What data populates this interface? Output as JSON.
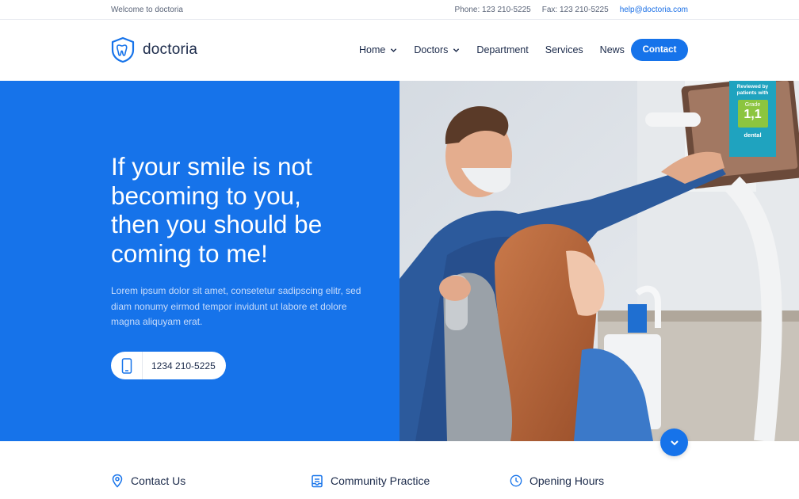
{
  "topbar": {
    "welcome": "Welcome to doctoria",
    "phone": "Phone: 123 210-5225",
    "fax": "Fax: 123 210-5225",
    "email": "help@doctoria.com"
  },
  "brand": {
    "name": "doctoria"
  },
  "nav": {
    "items": [
      {
        "label": "Home",
        "dropdown": true
      },
      {
        "label": "Doctors",
        "dropdown": true
      },
      {
        "label": "Department",
        "dropdown": false
      },
      {
        "label": "Services",
        "dropdown": false
      },
      {
        "label": "News",
        "dropdown": false
      }
    ],
    "contact_label": "Contact"
  },
  "hero": {
    "headline": [
      "If your smile is not",
      "becoming to you,",
      "then you should be",
      "coming to me!"
    ],
    "paragraph": "Lorem ipsum dolor sit amet, consetetur sadipscing elitr, sed diam nonumy eirmod tempor invidunt ut labore et dolore magna aliquyam erat.",
    "phone": "1234 210-5225"
  },
  "badge": {
    "top": "Reviewed by patients with",
    "grade_label": "Grade",
    "grade_value": "1,1",
    "brand": "dental"
  },
  "info": {
    "contact": "Contact Us",
    "community": "Community Practice",
    "hours": "Opening Hours"
  },
  "colors": {
    "accent": "#1673ea",
    "badge": "#1fa3bf",
    "grade": "#8cc53f"
  },
  "icons": [
    "tooth-shield-icon",
    "chevron-down-icon",
    "mobile-phone-icon",
    "map-pin-icon",
    "clipboard-icon",
    "clock-icon"
  ]
}
